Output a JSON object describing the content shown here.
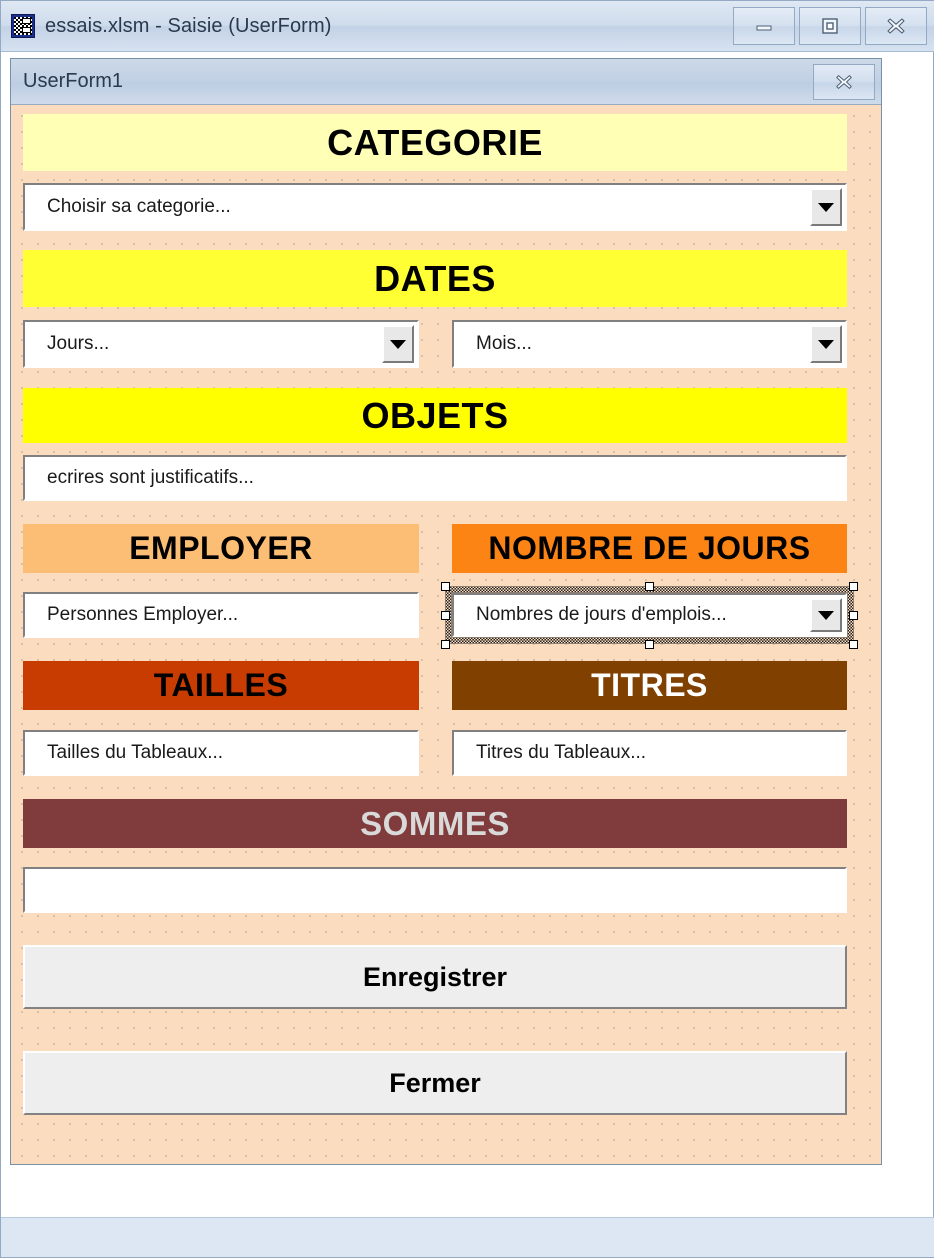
{
  "window": {
    "title": "essais.xlsm - Saisie (UserForm)",
    "icon": "userform-icon",
    "controls": {
      "minimize": "–",
      "restore": "▣",
      "close": "✕"
    }
  },
  "userform": {
    "title": "UserForm1",
    "close_label": "✕",
    "background_color": "#FBDCBE"
  },
  "sections": [
    {
      "id": "categorie",
      "label": "CATEGORIE",
      "bg": "#FFFFB5",
      "fg": "#000000",
      "field": {
        "type": "combobox",
        "value": "Choisir sa categorie...",
        "name": "categorie-combobox"
      }
    },
    {
      "id": "dates",
      "label": "DATES",
      "bg": "#FFFF33",
      "fg": "#000000",
      "fields": [
        {
          "type": "combobox",
          "value": "Jours...",
          "name": "jours-combobox"
        },
        {
          "type": "combobox",
          "value": "Mois...",
          "name": "mois-combobox"
        }
      ]
    },
    {
      "id": "objets",
      "label": "OBJETS",
      "bg": "#FFFF00",
      "fg": "#000000",
      "field": {
        "type": "textbox",
        "value": "ecrires sont justificatifs...",
        "name": "objets-textbox"
      }
    },
    {
      "id": "employer",
      "label": "EMPLOYER",
      "bg": "#FCBE74",
      "fg": "#000000",
      "field": {
        "type": "textbox",
        "value": "Personnes Employer...",
        "name": "employer-textbox"
      }
    },
    {
      "id": "nombre_de_jours",
      "label": "NOMBRE DE JOURS",
      "bg": "#FC8415",
      "fg": "#000000",
      "field": {
        "type": "combobox",
        "value": "Nombres de jours d'emplois...",
        "name": "nombre-jours-combobox",
        "selected": true
      }
    },
    {
      "id": "tailles",
      "label": "TAILLES",
      "bg": "#C83C02",
      "fg": "#000000",
      "field": {
        "type": "textbox",
        "value": "Tailles du Tableaux...",
        "name": "tailles-textbox"
      }
    },
    {
      "id": "titres",
      "label": "TITRES",
      "bg": "#7F4000",
      "fg": "#FFFFFF",
      "field": {
        "type": "textbox",
        "value": "Titres du Tableaux...",
        "name": "titres-textbox"
      }
    },
    {
      "id": "sommes",
      "label": "SOMMES",
      "bg": "#803C3C",
      "fg": "#D9D9D9",
      "field": {
        "type": "textbox",
        "value": "",
        "name": "sommes-textbox"
      }
    }
  ],
  "buttons": {
    "save": "Enregistrer",
    "close": "Fermer"
  }
}
